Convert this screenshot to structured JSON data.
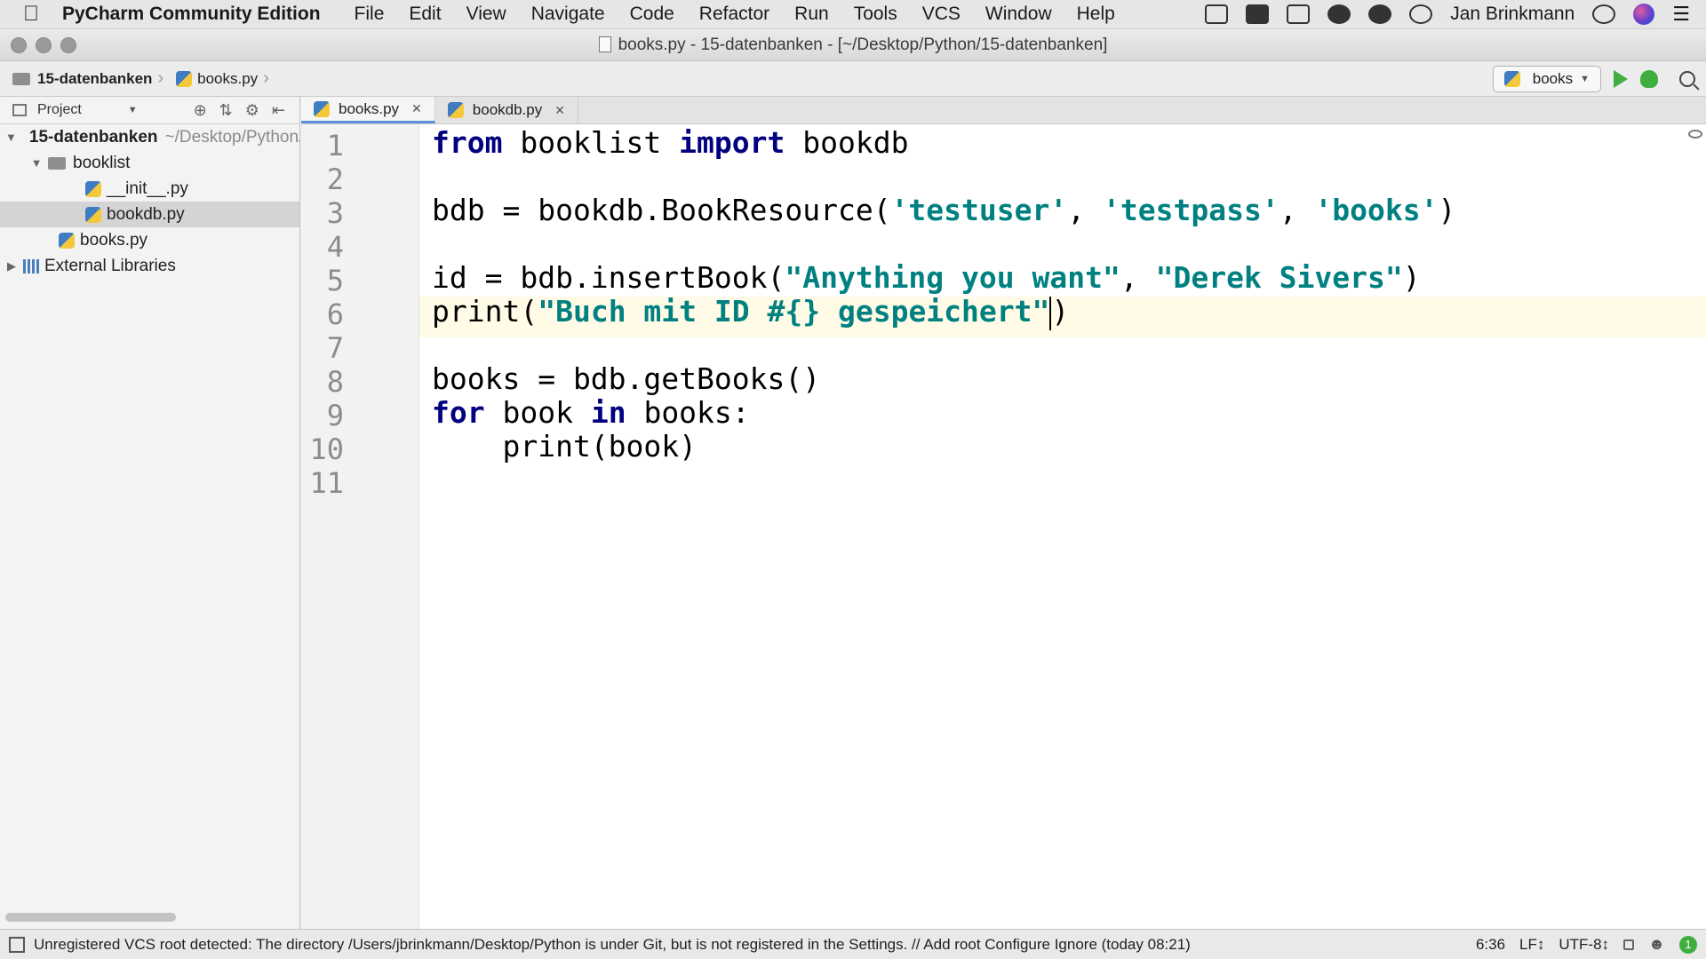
{
  "menubar": {
    "app_name": "PyCharm Community Edition",
    "items": [
      "File",
      "Edit",
      "View",
      "Navigate",
      "Code",
      "Refactor",
      "Run",
      "Tools",
      "VCS",
      "Window",
      "Help"
    ],
    "user": "Jan Brinkmann"
  },
  "window": {
    "title": "books.py - 15-datenbanken - [~/Desktop/Python/15-datenbanken]"
  },
  "navbar": {
    "breadcrumb_project": "15-datenbanken",
    "breadcrumb_file": "books.py",
    "run_config": "books"
  },
  "project_panel": {
    "title": "Project",
    "tree": [
      {
        "label": "15-datenbanken",
        "suffix": "~/Desktop/Python/15-datenbanken"
      },
      {
        "label": "booklist"
      },
      {
        "label": "__init__.py"
      },
      {
        "label": "bookdb.py"
      },
      {
        "label": "books.py"
      },
      {
        "label": "External Libraries"
      }
    ]
  },
  "tabs": [
    {
      "label": "books.py",
      "active": true
    },
    {
      "label": "bookdb.py",
      "active": false
    }
  ],
  "editor": {
    "line_numbers": [
      "1",
      "2",
      "3",
      "4",
      "5",
      "6",
      "7",
      "8",
      "9",
      "10",
      "11"
    ],
    "current_line": 6
  },
  "statusbar": {
    "message": "Unregistered VCS root detected: The directory /Users/jbrinkmann/Desktop/Python is under Git, but is not registered in the Settings. // Add root  Configure  Ignore (today 08:21)",
    "position": "6:36",
    "line_ending": "LF↕",
    "encoding": "UTF-8↕",
    "notifications": "1"
  }
}
